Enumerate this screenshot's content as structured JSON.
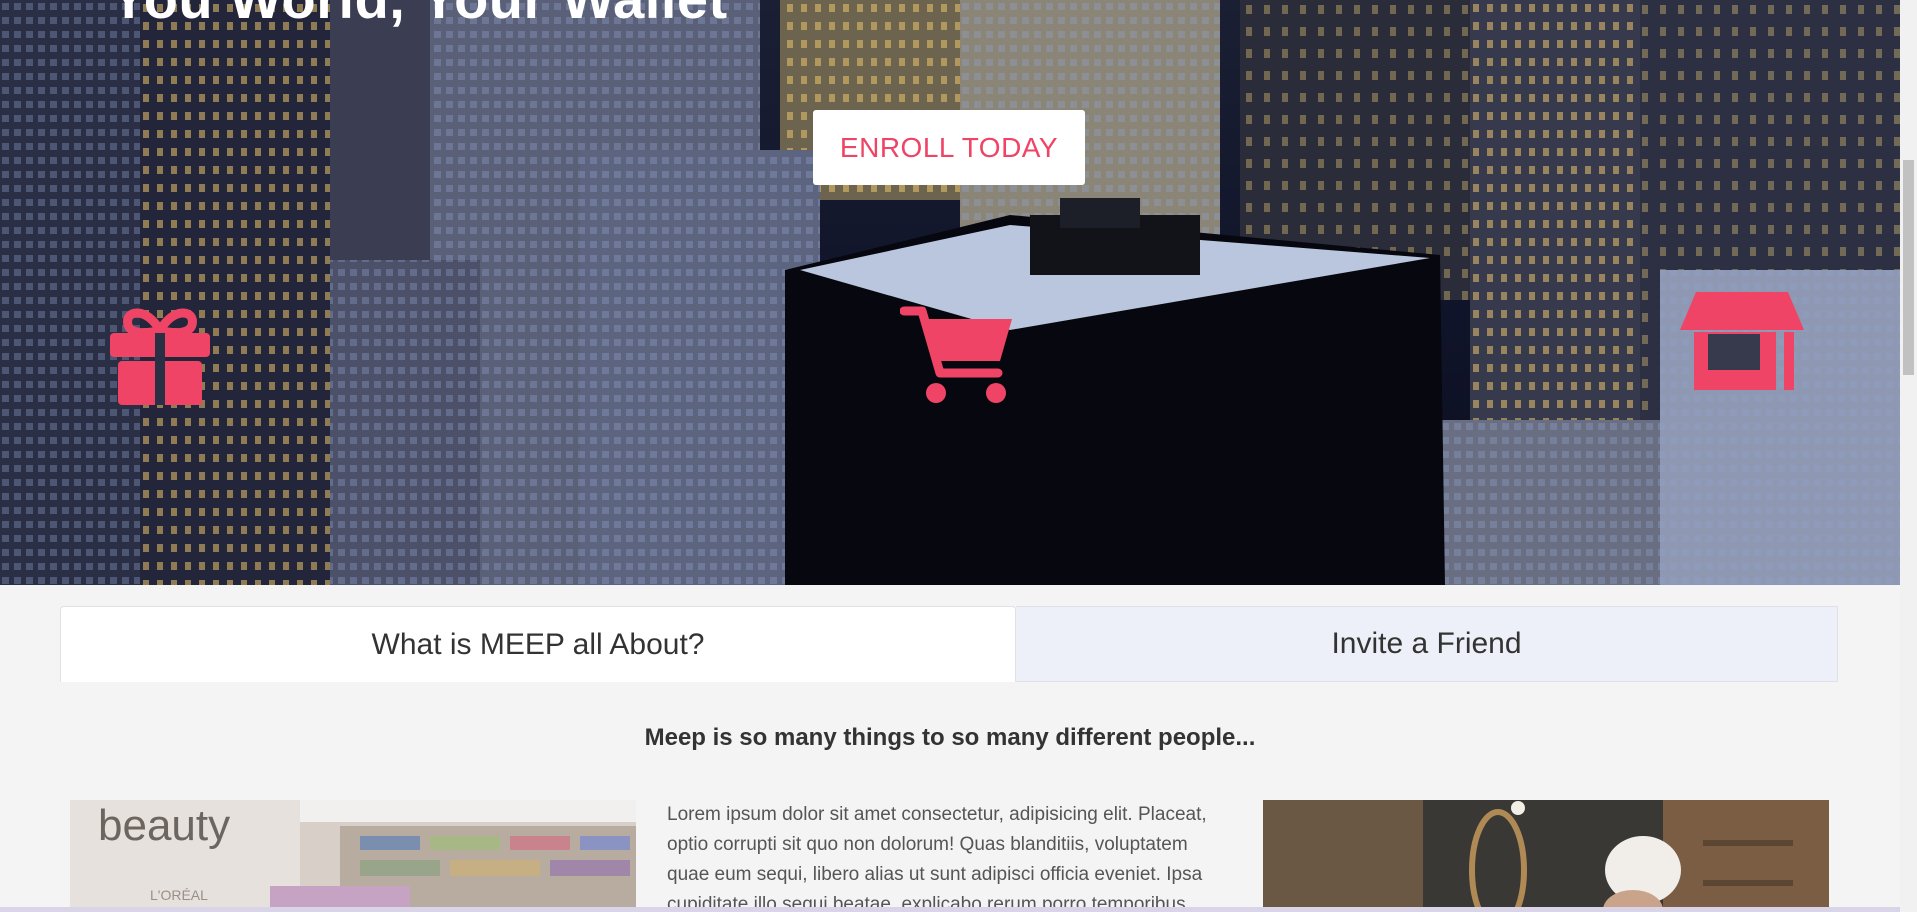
{
  "hero": {
    "title": "You World, Your Wallet",
    "enroll_label": "ENROLL TODAY",
    "icons": [
      "gift-icon",
      "cart-icon",
      "store-icon"
    ],
    "accent_color": "#ef4465"
  },
  "tabs": [
    {
      "label": "What is MEEP all About?",
      "active": true
    },
    {
      "label": "Invite a Friend",
      "active": false
    }
  ],
  "content": {
    "heading": "Meep is so many things to so many different people...",
    "paragraph": "Lorem ipsum dolor sit amet consectetur, adipisicing elit. Placeat, optio corrupti sit quo non dolorum! Quas blanditiis, voluptatem quae eum sequi, libero alias ut sunt adipisci officia eveniet. Ipsa cupiditate illo sequi beatae, explicabo rerum porro temporibus"
  },
  "photos": {
    "left_sign": "beauty",
    "left_brand": "L'ORÉAL"
  }
}
